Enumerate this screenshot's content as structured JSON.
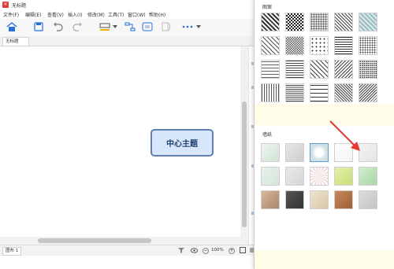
{
  "window": {
    "title": "无标题"
  },
  "menu": [
    "文件(F)",
    "编辑(E)",
    "查看(V)",
    "插入(I)",
    "修改(M)",
    "工具(T)",
    "窗口(W)",
    "帮助(H)"
  ],
  "tab": {
    "label": "无标题"
  },
  "central_topic": "中心主题",
  "status": {
    "sheet": "图布 1",
    "zoom": "100%"
  },
  "panel": {
    "section1_title": "图案",
    "section2_title": "墙纸",
    "pattern_count": 15,
    "wallpaper_count": 15,
    "arrow_color": "#e53935"
  },
  "colors": {
    "topic_fill": "#d8e6fb",
    "topic_border": "#5e7fb0",
    "accent": "#2a6fd6"
  }
}
